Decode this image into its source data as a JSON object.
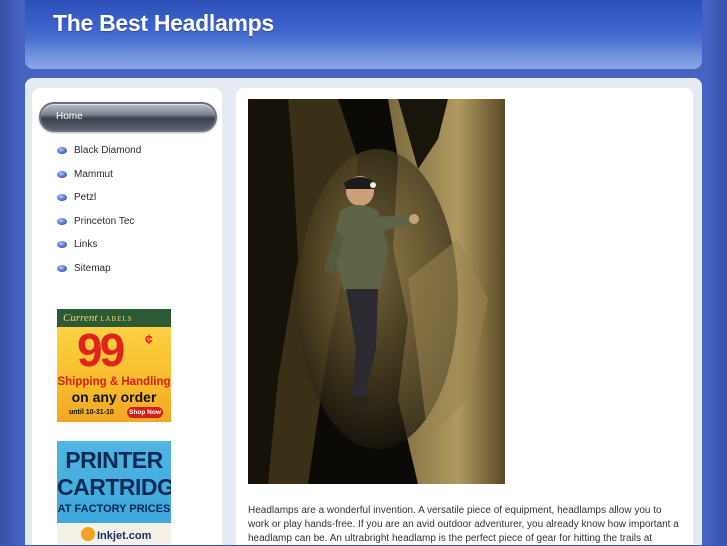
{
  "header": {
    "title": "The Best Headlamps"
  },
  "nav": {
    "home_label": "Home",
    "items": [
      "Black Diamond",
      "Mammut",
      "Petzl",
      "Princeton Tec",
      "Links",
      "Sitemap"
    ]
  },
  "ads": {
    "labels": {
      "brand": "Current",
      "brand_tag": "LABELS",
      "price": "99",
      "cent": "¢",
      "line1": "Shipping & Handling",
      "line2": "on any order",
      "until": "until 10-31-10",
      "shop": "Shop Now"
    },
    "printer": {
      "line1": "PRINTER",
      "line2": "CARTRIDGES",
      "line3": "AT FACTORY PRICES",
      "brand": "Inkjet.com"
    }
  },
  "content": {
    "paragraph": "Headlamps are a wonderful invention. A versatile piece of equipment, headlamps allow you to work or play hands-free. If you are an avid outdoor adventurer, you already know how important a headlamp can be. An ultrabright headlamp is the perfect piece of gear for hitting the trails at"
  },
  "colors": {
    "background": "#3c57b0",
    "header": "#3f66cc",
    "panel": "#e6ebf3"
  }
}
